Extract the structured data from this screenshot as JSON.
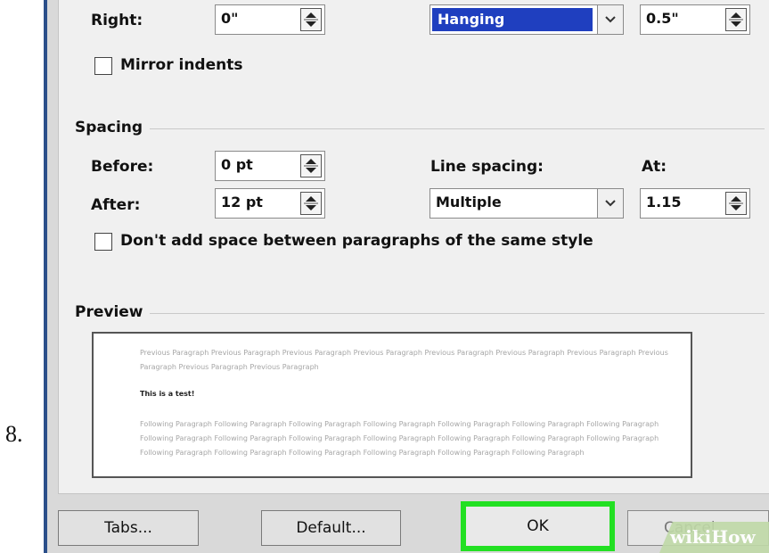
{
  "step_number": "8.",
  "indentation": {
    "right_label": "Right:",
    "right_value": "0\"",
    "special_value": "Hanging",
    "by_value": "0.5\"",
    "mirror_label": "Mirror indents"
  },
  "spacing": {
    "group_label": "Spacing",
    "before_label": "Before:",
    "before_value": "0 pt",
    "after_label": "After:",
    "after_value": "12 pt",
    "line_spacing_label": "Line spacing:",
    "line_spacing_value": "Multiple",
    "at_label": "At:",
    "at_value": "1.15",
    "dont_add_label": "Don't add space between paragraphs of the same style"
  },
  "preview": {
    "group_label": "Preview",
    "previous_text": "Previous Paragraph Previous Paragraph Previous Paragraph Previous Paragraph Previous Paragraph Previous Paragraph Previous Paragraph Previous Paragraph Previous Paragraph Previous Paragraph",
    "test_text": "This is a test!",
    "following_text": "Following Paragraph Following Paragraph Following Paragraph Following Paragraph Following Paragraph Following Paragraph Following Paragraph Following Paragraph Following Paragraph Following Paragraph Following Paragraph Following Paragraph Following Paragraph Following Paragraph Following Paragraph Following Paragraph Following Paragraph Following Paragraph Following Paragraph Following Paragraph"
  },
  "buttons": {
    "tabs": "Tabs...",
    "default": "Default...",
    "ok": "OK",
    "cancel": "Cancel"
  },
  "watermark": "wikiHow",
  "colors": {
    "highlight_green": "#22e022",
    "selection_blue": "#1f3fbf",
    "dialog_bg": "#f0f0f0"
  }
}
